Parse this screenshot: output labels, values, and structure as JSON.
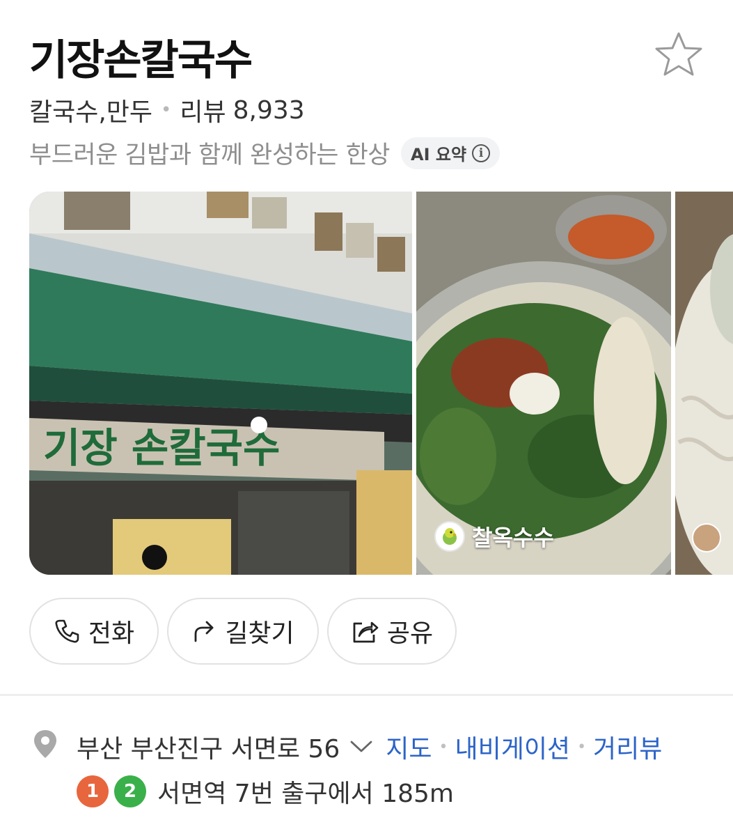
{
  "place": {
    "name": "기장손칼국수",
    "category": "칼국수,만두",
    "review_label": "리뷰",
    "review_count": "8,933",
    "summary": "부드러운 김밥과 함께 완성하는 한상",
    "ai_chip_label": "AI 요약",
    "ai_chip_icon": "info-icon",
    "favorite_icon": "star-outline-icon"
  },
  "gallery": {
    "photos": [
      {
        "subject": "storefront",
        "sign_text": "기장 손칼국수"
      },
      {
        "subject": "kalguksu-dish",
        "credit_name": "찰옥수수",
        "credit_icon": "parrot-avatar-icon"
      },
      {
        "subject": "noodles-partial"
      }
    ]
  },
  "actions": [
    {
      "label": "전화",
      "icon": "phone-icon"
    },
    {
      "label": "길찾기",
      "icon": "directions-arrow-icon"
    },
    {
      "label": "공유",
      "icon": "share-icon"
    }
  ],
  "location": {
    "address": "부산 부산진구 서면로 56",
    "expand_icon": "chevron-down-icon",
    "links": [
      "지도",
      "내비게이션",
      "거리뷰"
    ],
    "subway": {
      "lines": [
        {
          "number": "1",
          "color": "#e8663d"
        },
        {
          "number": "2",
          "color": "#3ab04a"
        }
      ],
      "text": "서면역 7번 출구에서 185m"
    }
  },
  "colors": {
    "link": "#2c64c8",
    "muted_text": "#8e8e8e",
    "line1": "#e8663d",
    "line2": "#3ab04a"
  }
}
